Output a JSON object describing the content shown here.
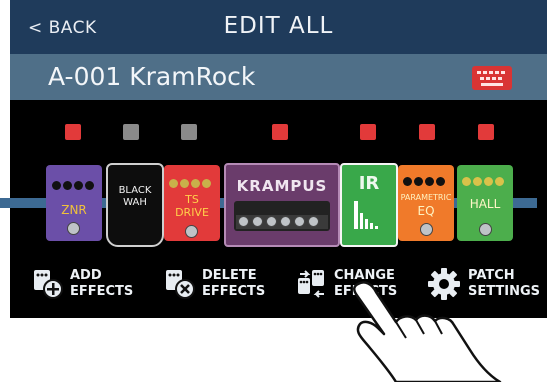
{
  "header": {
    "back_label": "< BACK",
    "title": "EDIT ALL"
  },
  "patch": {
    "name": "A-001 KramRock"
  },
  "leds": [
    "on",
    "off",
    "off",
    "on",
    "on",
    "on",
    "on"
  ],
  "colors": {
    "led_on": "#e23a3a",
    "led_off": "#8a8a8a",
    "title_bar": "#1f3b5b",
    "patch_bar": "#4f6f88",
    "rail": "#3d6a93"
  },
  "effects": [
    {
      "label": "ZNR",
      "color": "#6b4fa8"
    },
    {
      "label_line1": "BLACK",
      "label_line2": "WAH",
      "color": "#111111"
    },
    {
      "label_line1": "TS",
      "label_line2": "DRIVE",
      "color": "#e23a3a"
    },
    {
      "label": "KRAMPUS",
      "color": "#6a3c6b"
    },
    {
      "label": "IR",
      "color": "#39a84a"
    },
    {
      "label_line1": "PARAMETRIC",
      "label_line2": "EQ",
      "color": "#f07a2a"
    },
    {
      "label": "HALL",
      "color": "#4cae4c"
    }
  ],
  "actions": [
    {
      "line1": "ADD",
      "line2": "EFFECTS",
      "icon": "add-effects-icon"
    },
    {
      "line1": "DELETE",
      "line2": "EFFECTS",
      "icon": "delete-effects-icon"
    },
    {
      "line1": "CHANGE",
      "line2": "EFFECTS",
      "icon": "change-effects-icon"
    },
    {
      "line1": "PATCH",
      "line2": "SETTINGS",
      "icon": "gear-icon"
    }
  ]
}
